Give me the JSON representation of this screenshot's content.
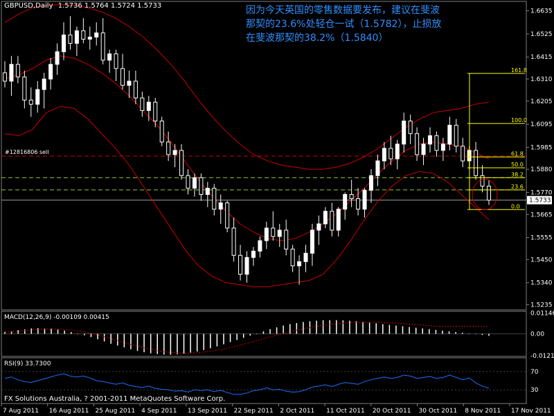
{
  "header": {
    "symbol": "GBPUSD,Daily",
    "ohlc": "1.5736 1.5764 1.5724 1.5733"
  },
  "annotation": {
    "lines": [
      "因为今天英国的零售数据要发布，建议在斐波",
      "那契的23.6%处轻仓一试（1.5782），止损放",
      "在斐波那契的38.2%（1.5840）"
    ]
  },
  "order_label": "#12816806 sell",
  "copyright": "FX Solutions Australia, ? 2001-2011 MetaQuotes Software Corp.",
  "colors": {
    "background": "#000000",
    "up_candle": "#ffffff",
    "down_candle": "#000000",
    "bollinger": "#cc0000",
    "macd_hist": "#ffffff",
    "macd_signal": "#cc0000",
    "rsi": "#1e6fff",
    "fib": "#ffff00",
    "order_line": "#cc0000",
    "annotation": "#2f8fff"
  },
  "chart_data": [
    {
      "type": "candlestick",
      "panel": "main",
      "ylim": [
        1.521,
        1.668
      ],
      "y_ticks": [
        "1.6635",
        "1.6525",
        "1.6415",
        "1.6310",
        "1.6205",
        "1.6095",
        "1.5985",
        "1.5880",
        "1.5770",
        "1.5665",
        "1.5555",
        "1.5450",
        "1.5340",
        "1.5235"
      ],
      "y_tick_values": [
        1.6635,
        1.6525,
        1.6415,
        1.631,
        1.6205,
        1.6095,
        1.5985,
        1.588,
        1.577,
        1.5665,
        1.5555,
        1.545,
        1.534,
        1.5235
      ],
      "x_ticks": [
        "7 Aug 2011",
        "16 Aug 2011",
        "25 Aug 2011",
        "4 Sep 2011",
        "13 Sep 2011",
        "22 Sep 2011",
        "2 Oct 2011",
        "11 Oct 2011",
        "20 Oct 2011",
        "30 Oct 2011",
        "8 Nov 2011",
        "17 Nov 2011"
      ],
      "candles": [
        [
          1.634,
          1.6395,
          1.627,
          1.63
        ],
        [
          1.63,
          1.642,
          1.623,
          1.638
        ],
        [
          1.638,
          1.642,
          1.629,
          1.632
        ],
        [
          1.632,
          1.635,
          1.617,
          1.621
        ],
        [
          1.621,
          1.627,
          1.613,
          1.619
        ],
        [
          1.619,
          1.63,
          1.615,
          1.626
        ],
        [
          1.626,
          1.634,
          1.617,
          1.631
        ],
        [
          1.631,
          1.641,
          1.626,
          1.638
        ],
        [
          1.638,
          1.648,
          1.633,
          1.644
        ],
        [
          1.644,
          1.658,
          1.64,
          1.652
        ],
        [
          1.652,
          1.661,
          1.645,
          1.648
        ],
        [
          1.648,
          1.656,
          1.642,
          1.654
        ],
        [
          1.654,
          1.66,
          1.648,
          1.65
        ],
        [
          1.65,
          1.656,
          1.645,
          1.651
        ],
        [
          1.651,
          1.658,
          1.647,
          1.653
        ],
        [
          1.653,
          1.66,
          1.638,
          1.64
        ],
        [
          1.64,
          1.645,
          1.634,
          1.643
        ],
        [
          1.643,
          1.645,
          1.63,
          1.636
        ],
        [
          1.636,
          1.643,
          1.626,
          1.628
        ],
        [
          1.628,
          1.635,
          1.622,
          1.63
        ],
        [
          1.63,
          1.635,
          1.619,
          1.622
        ],
        [
          1.622,
          1.625,
          1.613,
          1.616
        ],
        [
          1.616,
          1.623,
          1.611,
          1.62
        ],
        [
          1.62,
          1.622,
          1.608,
          1.611
        ],
        [
          1.611,
          1.613,
          1.599,
          1.601
        ],
        [
          1.601,
          1.606,
          1.592,
          1.595
        ],
        [
          1.595,
          1.6,
          1.589,
          1.597
        ],
        [
          1.597,
          1.6,
          1.583,
          1.585
        ],
        [
          1.585,
          1.588,
          1.576,
          1.579
        ],
        [
          1.579,
          1.586,
          1.575,
          1.584
        ],
        [
          1.584,
          1.586,
          1.573,
          1.576
        ],
        [
          1.576,
          1.582,
          1.57,
          1.579
        ],
        [
          1.579,
          1.581,
          1.566,
          1.569
        ],
        [
          1.569,
          1.576,
          1.562,
          1.572
        ],
        [
          1.572,
          1.573,
          1.558,
          1.56
        ],
        [
          1.56,
          1.565,
          1.544,
          1.547
        ],
        [
          1.547,
          1.552,
          1.535,
          1.538
        ],
        [
          1.538,
          1.549,
          1.534,
          1.546
        ],
        [
          1.546,
          1.551,
          1.542,
          1.549
        ],
        [
          1.549,
          1.556,
          1.546,
          1.554
        ],
        [
          1.554,
          1.563,
          1.55,
          1.56
        ],
        [
          1.56,
          1.568,
          1.554,
          1.556
        ],
        [
          1.556,
          1.562,
          1.551,
          1.559
        ],
        [
          1.559,
          1.564,
          1.547,
          1.55
        ],
        [
          1.55,
          1.552,
          1.539,
          1.542
        ],
        [
          1.542,
          1.547,
          1.533,
          1.544
        ],
        [
          1.544,
          1.552,
          1.539,
          1.548
        ],
        [
          1.548,
          1.562,
          1.542,
          1.559
        ],
        [
          1.559,
          1.566,
          1.552,
          1.562
        ],
        [
          1.562,
          1.57,
          1.56,
          1.568
        ],
        [
          1.568,
          1.572,
          1.556,
          1.559
        ],
        [
          1.559,
          1.57,
          1.556,
          1.569
        ],
        [
          1.569,
          1.577,
          1.564,
          1.576
        ],
        [
          1.576,
          1.583,
          1.57,
          1.574
        ],
        [
          1.574,
          1.579,
          1.566,
          1.569
        ],
        [
          1.569,
          1.579,
          1.565,
          1.578
        ],
        [
          1.578,
          1.588,
          1.572,
          1.585
        ],
        [
          1.585,
          1.595,
          1.58,
          1.592
        ],
        [
          1.592,
          1.601,
          1.588,
          1.598
        ],
        [
          1.598,
          1.604,
          1.59,
          1.593
        ],
        [
          1.593,
          1.602,
          1.588,
          1.6
        ],
        [
          1.6,
          1.615,
          1.596,
          1.611
        ],
        [
          1.611,
          1.614,
          1.6,
          1.605
        ],
        [
          1.605,
          1.608,
          1.592,
          1.595
        ],
        [
          1.595,
          1.603,
          1.59,
          1.6
        ],
        [
          1.6,
          1.608,
          1.596,
          1.604
        ],
        [
          1.604,
          1.606,
          1.594,
          1.597
        ],
        [
          1.597,
          1.603,
          1.592,
          1.6
        ],
        [
          1.6,
          1.613,
          1.597,
          1.609
        ],
        [
          1.609,
          1.612,
          1.596,
          1.599
        ],
        [
          1.599,
          1.603,
          1.589,
          1.592
        ],
        [
          1.592,
          1.599,
          1.588,
          1.597
        ],
        [
          1.597,
          1.601,
          1.583,
          1.585
        ],
        [
          1.585,
          1.59,
          1.577,
          1.58
        ],
        [
          1.58,
          1.583,
          1.571,
          1.5733
        ]
      ]
    },
    {
      "type": "line",
      "panel": "main",
      "name": "Bollinger Bands",
      "upper": [
        1.658,
        1.662,
        1.665,
        1.666,
        1.6665,
        1.666,
        1.665,
        1.663,
        1.66,
        1.656,
        1.651,
        1.645,
        1.638,
        1.63,
        1.621,
        1.613,
        1.606,
        1.6,
        1.595,
        1.592,
        1.59,
        1.589,
        1.588,
        1.588,
        1.589,
        1.591,
        1.594,
        1.598,
        1.603,
        1.608,
        1.612,
        1.615,
        1.616,
        1.617,
        1.619,
        1.62
      ],
      "middle": [
        1.631,
        1.633,
        1.636,
        1.64,
        1.642,
        1.641,
        1.638,
        1.634,
        1.629,
        1.623,
        1.616,
        1.609,
        1.601,
        1.592,
        1.583,
        1.575,
        1.568,
        1.562,
        1.558,
        1.555,
        1.554,
        1.555,
        1.558,
        1.562,
        1.567,
        1.573,
        1.579,
        1.586,
        1.592,
        1.597,
        1.6,
        1.601,
        1.6,
        1.599,
        1.596,
        1.593
      ],
      "lower": [
        1.605,
        1.604,
        1.607,
        1.615,
        1.618,
        1.617,
        1.612,
        1.605,
        1.598,
        1.59,
        1.58,
        1.57,
        1.56,
        1.55,
        1.542,
        1.537,
        1.534,
        1.533,
        1.532,
        1.532,
        1.533,
        1.534,
        1.535,
        1.538,
        1.545,
        1.554,
        1.564,
        1.573,
        1.58,
        1.585,
        1.587,
        1.586,
        1.582,
        1.576,
        1.57,
        1.564
      ]
    },
    {
      "type": "bar",
      "panel": "macd",
      "name": "MACD(12,26,9)",
      "label": "MACD(12,26,9) -0.00109 0.00415",
      "ylim": [
        -0.0125,
        0.0125
      ],
      "y_ticks": [
        "0.01146",
        "0.00",
        "-0.0121"
      ],
      "y_tick_values": [
        0.01146,
        0.0,
        -0.0121
      ],
      "hist": [
        0.001,
        0.0015,
        0.002,
        0.0025,
        0.003,
        0.0032,
        0.003,
        0.0028,
        0.0024,
        0.0018,
        0.001,
        0.0002,
        -0.0008,
        -0.0018,
        -0.003,
        -0.0042,
        -0.0055,
        -0.0065,
        -0.0075,
        -0.0085,
        -0.0095,
        -0.0102,
        -0.0108,
        -0.0112,
        -0.0115,
        -0.0116,
        -0.0114,
        -0.011,
        -0.0104,
        -0.0098,
        -0.009,
        -0.008,
        -0.007,
        -0.0058,
        -0.0046,
        -0.0034,
        -0.0022,
        -0.001,
        0.0002,
        0.0014,
        0.0026,
        0.0036,
        0.0046,
        0.0054,
        0.006,
        0.0066,
        0.007,
        0.0073,
        0.0075,
        0.0076,
        0.0076,
        0.0075,
        0.0073,
        0.007,
        0.0066,
        0.0062,
        0.0058,
        0.0054,
        0.005,
        0.0046,
        0.0042,
        0.0038,
        0.0034,
        0.003,
        0.0026,
        0.0022,
        0.0018,
        0.0014,
        0.001,
        0.0006,
        0.0002,
        -0.0002,
        -0.0006,
        -0.0011
      ],
      "signal": [
        0.0012,
        0.0013,
        0.0015,
        0.0018,
        0.0021,
        0.0024,
        0.0026,
        0.0027,
        0.0026,
        0.0024,
        0.0021,
        0.0016,
        0.001,
        0.0003,
        -0.0006,
        -0.0016,
        -0.0026,
        -0.0037,
        -0.0048,
        -0.0059,
        -0.0069,
        -0.0078,
        -0.0086,
        -0.0093,
        -0.0099,
        -0.0103,
        -0.0106,
        -0.0107,
        -0.0107,
        -0.0105,
        -0.0102,
        -0.0097,
        -0.0091,
        -0.0084,
        -0.0076,
        -0.0067,
        -0.0058,
        -0.0048,
        -0.0038,
        -0.0027,
        -0.0017,
        -0.0007,
        0.0003,
        0.0012,
        0.0021,
        0.0028,
        0.0035,
        0.0041,
        0.0047,
        0.0052,
        0.0056,
        0.0059,
        0.0062,
        0.0063,
        0.0064,
        0.0064,
        0.0064,
        0.0063,
        0.0061,
        0.0059,
        0.0057,
        0.0054,
        0.0051,
        0.0048,
        0.0045,
        0.0042,
        0.004,
        0.0041,
        0.0042,
        0.0042,
        0.0042,
        0.0042,
        0.0042,
        0.0042
      ]
    },
    {
      "type": "line",
      "panel": "rsi",
      "name": "RSI(9)",
      "label": "RSI(9) 33.7300",
      "ylim": [
        0,
        100
      ],
      "y_ticks": [
        "70",
        "30"
      ],
      "y_tick_values": [
        70,
        30
      ],
      "values": [
        55,
        58,
        52,
        48,
        46,
        50,
        54,
        58,
        62,
        65,
        60,
        58,
        60,
        56,
        50,
        48,
        45,
        42,
        45,
        40,
        37,
        35,
        38,
        33,
        31,
        30,
        27,
        28,
        25,
        30,
        28,
        30,
        26,
        29,
        24,
        20,
        20,
        23,
        28,
        30,
        34,
        30,
        31,
        27,
        25,
        26,
        30,
        36,
        38,
        41,
        37,
        42,
        46,
        44,
        42,
        48,
        52,
        55,
        58,
        55,
        57,
        62,
        60,
        55,
        57,
        59,
        55,
        57,
        62,
        57,
        52,
        56,
        45,
        38,
        33.73
      ]
    },
    {
      "type": "fibonacci",
      "panel": "main",
      "levels": [
        {
          "label": "161.8",
          "price": 1.6337
        },
        {
          "label": "100.0",
          "price": 1.6098
        },
        {
          "label": "61.8",
          "price": 1.5939
        },
        {
          "label": "50.0",
          "price": 1.5887
        },
        {
          "label": "38.2",
          "price": 1.584
        },
        {
          "label": "23.6",
          "price": 1.5782
        },
        {
          "label": "0.0",
          "price": 1.5688
        }
      ]
    },
    {
      "type": "line",
      "panel": "main",
      "name": "order",
      "order_price": 1.5943,
      "bid_price": 1.5733,
      "bid_label": "1.5733",
      "green_levels": [
        1.584,
        1.5782
      ]
    }
  ]
}
